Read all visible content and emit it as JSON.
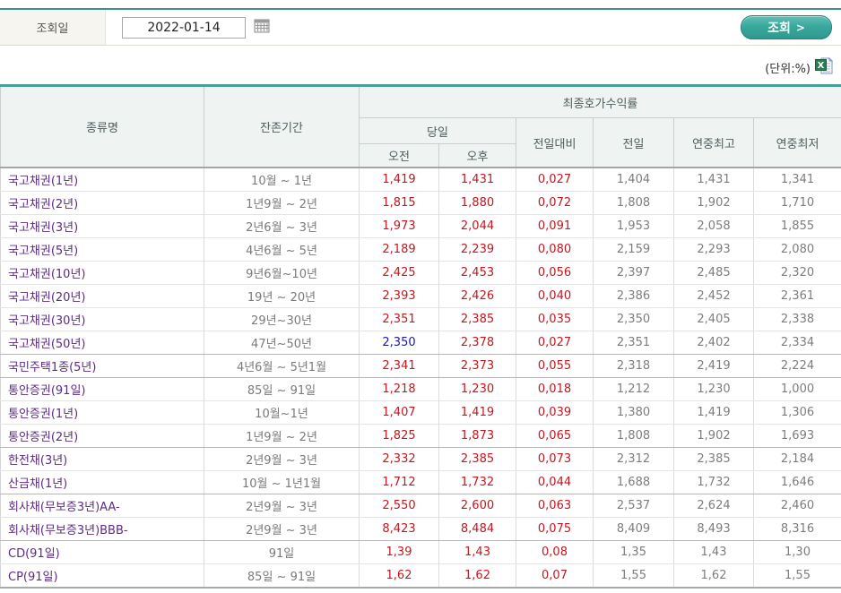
{
  "form": {
    "date_label": "조회일",
    "date_value": "2022-01-14",
    "search_label": "조회",
    "search_arrow": ">"
  },
  "unit_note": "(단위:%)",
  "icons": {
    "calendar": "calendar-icon",
    "excel_export": "excel-export-icon"
  },
  "colors": {
    "accent_teal": "#38948c",
    "table_top_border": "#48a098",
    "header_bg": "#eff4f3",
    "label_bg": "#f6f5ef",
    "button_teal": "#2e998f",
    "value_up_red": "#c01920",
    "value_down_blue": "#1a1aa6",
    "bond_name_purple": "#5b2c83",
    "muted_gray": "#7d7d7d"
  },
  "table": {
    "headers": {
      "type": "종류명",
      "period": "잔존기간",
      "yield_group": "최종호가수익률",
      "today_group": "당일",
      "am": "오전",
      "pm": "오후",
      "change": "전일대비",
      "prev": "전일",
      "year_high": "연중최고",
      "year_low": "연중최저"
    },
    "rows": [
      {
        "name": "국고채권(1년)",
        "period": "10월 ~ 1년",
        "am": "1,419",
        "pm": "1,431",
        "change": "0,027",
        "prev": "1,404",
        "high": "1,431",
        "low": "1,341",
        "am_dir": "up",
        "group_end": false
      },
      {
        "name": "국고채권(2년)",
        "period": "1년9월 ~ 2년",
        "am": "1,815",
        "pm": "1,880",
        "change": "0,072",
        "prev": "1,808",
        "high": "1,902",
        "low": "1,710",
        "am_dir": "up",
        "group_end": false
      },
      {
        "name": "국고채권(3년)",
        "period": "2년6월 ~ 3년",
        "am": "1,973",
        "pm": "2,044",
        "change": "0,091",
        "prev": "1,953",
        "high": "2,058",
        "low": "1,855",
        "am_dir": "up",
        "group_end": false
      },
      {
        "name": "국고채권(5년)",
        "period": "4년6월 ~ 5년",
        "am": "2,189",
        "pm": "2,239",
        "change": "0,080",
        "prev": "2,159",
        "high": "2,293",
        "low": "2,080",
        "am_dir": "up",
        "group_end": false
      },
      {
        "name": "국고채권(10년)",
        "period": "9년6월~10년",
        "am": "2,425",
        "pm": "2,453",
        "change": "0,056",
        "prev": "2,397",
        "high": "2,485",
        "low": "2,320",
        "am_dir": "up",
        "group_end": false
      },
      {
        "name": "국고채권(20년)",
        "period": "19년 ~ 20년",
        "am": "2,393",
        "pm": "2,426",
        "change": "0,040",
        "prev": "2,386",
        "high": "2,452",
        "low": "2,361",
        "am_dir": "up",
        "group_end": false
      },
      {
        "name": "국고채권(30년)",
        "period": "29년~30년",
        "am": "2,351",
        "pm": "2,385",
        "change": "0,035",
        "prev": "2,350",
        "high": "2,405",
        "low": "2,338",
        "am_dir": "up",
        "group_end": false
      },
      {
        "name": "국고채권(50년)",
        "period": "47년~50년",
        "am": "2,350",
        "pm": "2,378",
        "change": "0,027",
        "prev": "2,351",
        "high": "2,402",
        "low": "2,334",
        "am_dir": "down",
        "group_end": true
      },
      {
        "name": "국민주택1종(5년)",
        "period": "4년6월 ~ 5년1월",
        "am": "2,341",
        "pm": "2,373",
        "change": "0,055",
        "prev": "2,318",
        "high": "2,419",
        "low": "2,224",
        "am_dir": "up",
        "group_end": true
      },
      {
        "name": "통안증권(91일)",
        "period": "85일 ~ 91일",
        "am": "1,218",
        "pm": "1,230",
        "change": "0,018",
        "prev": "1,212",
        "high": "1,230",
        "low": "1,000",
        "am_dir": "up",
        "group_end": false
      },
      {
        "name": "통안증권(1년)",
        "period": "10월~1년",
        "am": "1,407",
        "pm": "1,419",
        "change": "0,039",
        "prev": "1,380",
        "high": "1,419",
        "low": "1,306",
        "am_dir": "up",
        "group_end": false
      },
      {
        "name": "통안증권(2년)",
        "period": "1년9월 ~ 2년",
        "am": "1,825",
        "pm": "1,873",
        "change": "0,065",
        "prev": "1,808",
        "high": "1,902",
        "low": "1,693",
        "am_dir": "up",
        "group_end": true
      },
      {
        "name": "한전채(3년)",
        "period": "2년9월 ~ 3년",
        "am": "2,332",
        "pm": "2,385",
        "change": "0,073",
        "prev": "2,312",
        "high": "2,385",
        "low": "2,184",
        "am_dir": "up",
        "group_end": false
      },
      {
        "name": "산금채(1년)",
        "period": "10월 ~ 1년1월",
        "am": "1,712",
        "pm": "1,732",
        "change": "0,044",
        "prev": "1,688",
        "high": "1,732",
        "low": "1,646",
        "am_dir": "up",
        "group_end": true
      },
      {
        "name": "회사채(무보증3년)AA-",
        "period": "2년9월 ~ 3년",
        "am": "2,550",
        "pm": "2,600",
        "change": "0,063",
        "prev": "2,537",
        "high": "2,624",
        "low": "2,460",
        "am_dir": "up",
        "group_end": false
      },
      {
        "name": "회사채(무보증3년)BBB-",
        "period": "2년9월 ~ 3년",
        "am": "8,423",
        "pm": "8,484",
        "change": "0,075",
        "prev": "8,409",
        "high": "8,493",
        "low": "8,316",
        "am_dir": "up",
        "group_end": true
      },
      {
        "name": "CD(91일)",
        "period": "91일",
        "am": "1,39",
        "pm": "1,43",
        "change": "0,08",
        "prev": "1,35",
        "high": "1,43",
        "low": "1,30",
        "am_dir": "up",
        "group_end": false
      },
      {
        "name": "CP(91일)",
        "period": "85일 ~ 91일",
        "am": "1,62",
        "pm": "1,62",
        "change": "0,07",
        "prev": "1,55",
        "high": "1,62",
        "low": "1,55",
        "am_dir": "up",
        "group_end": false
      }
    ]
  }
}
